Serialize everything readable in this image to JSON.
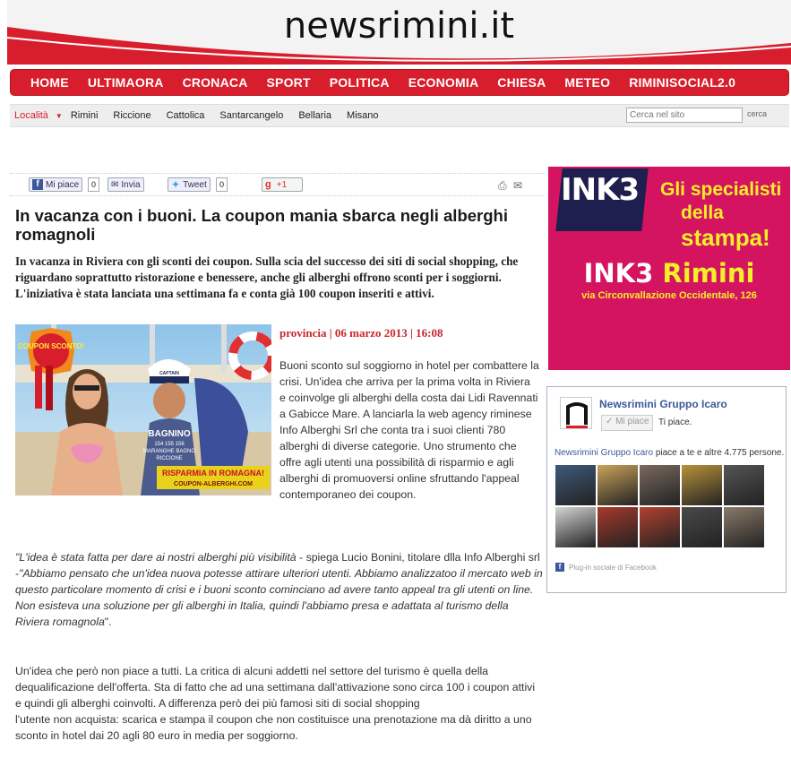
{
  "site": {
    "logo": "newsrimini.it"
  },
  "nav": [
    "HOME",
    "ULTIMAORA",
    "CRONACA",
    "SPORT",
    "POLITICA",
    "ECONOMIA",
    "CHIESA",
    "METEO",
    "RIMINISOCIAL2.0"
  ],
  "subnav": {
    "label": "Località",
    "towns": [
      "Rimini",
      "Riccione",
      "Cattolica",
      "Santarcangelo",
      "Bellaria",
      "Misano"
    ],
    "search_placeholder": "Cerca nel sito",
    "search_button": "cerca"
  },
  "share": {
    "fb_like": "Mi piace",
    "fb_count": "0",
    "send": "Invia",
    "tweet": "Tweet",
    "tweet_count": "0",
    "gplus": "+1"
  },
  "article": {
    "title": "In vacanza con i buoni. La coupon mania sbarca negli alberghi romagnoli",
    "lead": "In vacanza in Riviera con gli sconti dei coupon. Sulla scia del successo dei siti di social shopping, che riguardano soprattutto ristorazione e benessere, anche gli alberghi offrono sconti per i soggiorni. L'iniziativa è stata lanciata una settimana fa e conta già 100 coupon inseriti e attivi.",
    "section": "provincia",
    "date": "06 marzo 2013",
    "time": "16:08",
    "photo": {
      "badge": "COUPON SCONTO!",
      "cap": "CAPTAIN",
      "shirt_1": "BAGNINO",
      "shirt_2": "154 155 156",
      "shirt_3": "MARANGHE BAGNO",
      "shirt_4": "RICCIONE",
      "banner_1": "RISPARMIA IN ROMAGNA!",
      "banner_2": "COUPON-ALBERGHI.COM"
    },
    "body1": "Buoni sconto sul soggiorno in hotel per combattere la crisi. Un'idea che arriva per la prima volta in Riviera e coinvolge gli alberghi della costa dai Lidi Ravennati a Gabicce Mare. A lanciarla la web agency riminese Info Alberghi Srl che conta tra i suoi clienti 780 alberghi di diverse categorie. Uno strumento che offre agli utenti una possibilità di risparmio e agli alberghi di promuoversi online sfruttando l'appeal contemporaneo dei coupon.",
    "quote_a": "\"L'idea è stata fatta per dare ai nostri alberghi più visibilità",
    "quote_who": " - spiega Lucio Bonini, titolare dlla Info Alberghi srl -",
    "quote_b": "\"Abbiamo pensato che un'idea nuova potesse attirare ulteriori utenti. Abbiamo analizzatoo il mercato web in questo particolare momento di crisi e i buoni sconto cominciano ad avere tanto appeal tra gli utenti on line. Non esisteva una soluzione per gli alberghi in Italia, quindi l'abbiamo presa e adattata al turismo della Riviera romagnola",
    "quote_end": "\".",
    "body2a": "Un'idea che però non piace a tutti. La critica di alcuni addetti nel settore del turismo è quella della dequalificazione dell'offerta. Sta di fatto che ad una settimana dall'attivazione sono circa 100 i coupon attivi e quindi gli alberghi coinvolti. A differenza però dei più famosi siti di social shopping",
    "body2b": "l'utente non acquista: scarica e stampa il coupon che non costituisce una prenotazione ma dà diritto a uno sconto in hotel dai 20 agli 80 euro in media per soggiorno."
  },
  "ad": {
    "brand": "INK3",
    "tagline_1": "Gli specialisti",
    "tagline_2a": "della ",
    "tagline_2b": "stampa!",
    "city_a": "INK3 ",
    "city_b": "Rimini",
    "address": "via Circonvallazione Occidentale, 126"
  },
  "facebook": {
    "page_name": "Newsrimini Gruppo Icaro",
    "like_button": "Mi piace",
    "likes_text": "Ti piace.",
    "friends_name": "Newsrimini Gruppo Icaro",
    "friends_text": " piace a te e altre 4.775 persone.",
    "plugin": "Plug-in sociale di Facebook",
    "face_colors": [
      "#3f5a7a",
      "#c9a35a",
      "#7a6a5e",
      "#b8923c",
      "#555555",
      "#d4d4d4",
      "#a63a2a",
      "#b2412f",
      "#4a4a4a",
      "#8a7a6a"
    ]
  }
}
